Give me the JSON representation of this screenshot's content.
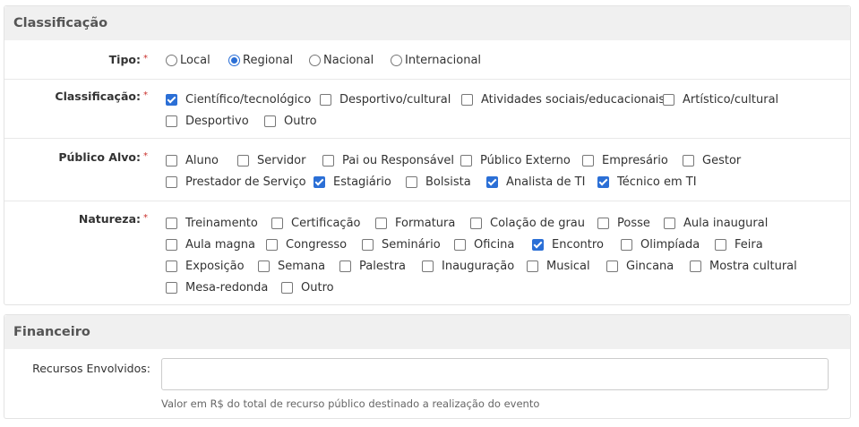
{
  "classificacao_panel": {
    "title": "Classificação",
    "required_marker": "*",
    "tipo": {
      "label": "Tipo:",
      "options": [
        {
          "label": "Local",
          "checked": false
        },
        {
          "label": "Regional",
          "checked": true
        },
        {
          "label": "Nacional",
          "checked": false
        },
        {
          "label": "Internacional",
          "checked": false
        }
      ]
    },
    "classificacao": {
      "label": "Classificação:",
      "options": [
        {
          "label": "Científico/tecnológico",
          "checked": true
        },
        {
          "label": "Desportivo/cultural",
          "checked": false
        },
        {
          "label": "Atividades sociais/educacionais",
          "checked": false
        },
        {
          "label": "Artístico/cultural",
          "checked": false
        },
        {
          "label": "Desportivo",
          "checked": false
        },
        {
          "label": "Outro",
          "checked": false
        }
      ]
    },
    "publico_alvo": {
      "label": "Público Alvo:",
      "options": [
        {
          "label": "Aluno",
          "checked": false
        },
        {
          "label": "Servidor",
          "checked": false
        },
        {
          "label": "Pai ou Responsável",
          "checked": false
        },
        {
          "label": "Público Externo",
          "checked": false
        },
        {
          "label": "Empresário",
          "checked": false
        },
        {
          "label": "Gestor",
          "checked": false
        },
        {
          "label": "Prestador de Serviço",
          "checked": false
        },
        {
          "label": "Estagiário",
          "checked": true
        },
        {
          "label": "Bolsista",
          "checked": false
        },
        {
          "label": "Analista de TI",
          "checked": true
        },
        {
          "label": "Técnico em TI",
          "checked": true
        }
      ]
    },
    "natureza": {
      "label": "Natureza:",
      "options": [
        {
          "label": "Treinamento",
          "checked": false
        },
        {
          "label": "Certificação",
          "checked": false
        },
        {
          "label": "Formatura",
          "checked": false
        },
        {
          "label": "Colação de grau",
          "checked": false
        },
        {
          "label": "Posse",
          "checked": false
        },
        {
          "label": "Aula inaugural",
          "checked": false
        },
        {
          "label": "Aula magna",
          "checked": false
        },
        {
          "label": "Congresso",
          "checked": false
        },
        {
          "label": "Seminário",
          "checked": false
        },
        {
          "label": "Oficina",
          "checked": false
        },
        {
          "label": "Encontro",
          "checked": true
        },
        {
          "label": "Olimpíada",
          "checked": false
        },
        {
          "label": "Feira",
          "checked": false
        },
        {
          "label": "Exposição",
          "checked": false
        },
        {
          "label": "Semana",
          "checked": false
        },
        {
          "label": "Palestra",
          "checked": false
        },
        {
          "label": "Inauguração",
          "checked": false
        },
        {
          "label": "Musical",
          "checked": false
        },
        {
          "label": "Gincana",
          "checked": false
        },
        {
          "label": "Mostra cultural",
          "checked": false
        },
        {
          "label": "Mesa-redonda",
          "checked": false
        },
        {
          "label": "Outro",
          "checked": false
        }
      ]
    }
  },
  "financeiro_panel": {
    "title": "Financeiro",
    "recursos_label": "Recursos Envolvidos:",
    "recursos_value": "",
    "recursos_help": "Valor em R$ do total de recurso público destinado a realização do evento"
  },
  "colors": {
    "accent": "#2b6fd6",
    "required": "#c9302c",
    "header_bg": "#f0f0f0"
  }
}
